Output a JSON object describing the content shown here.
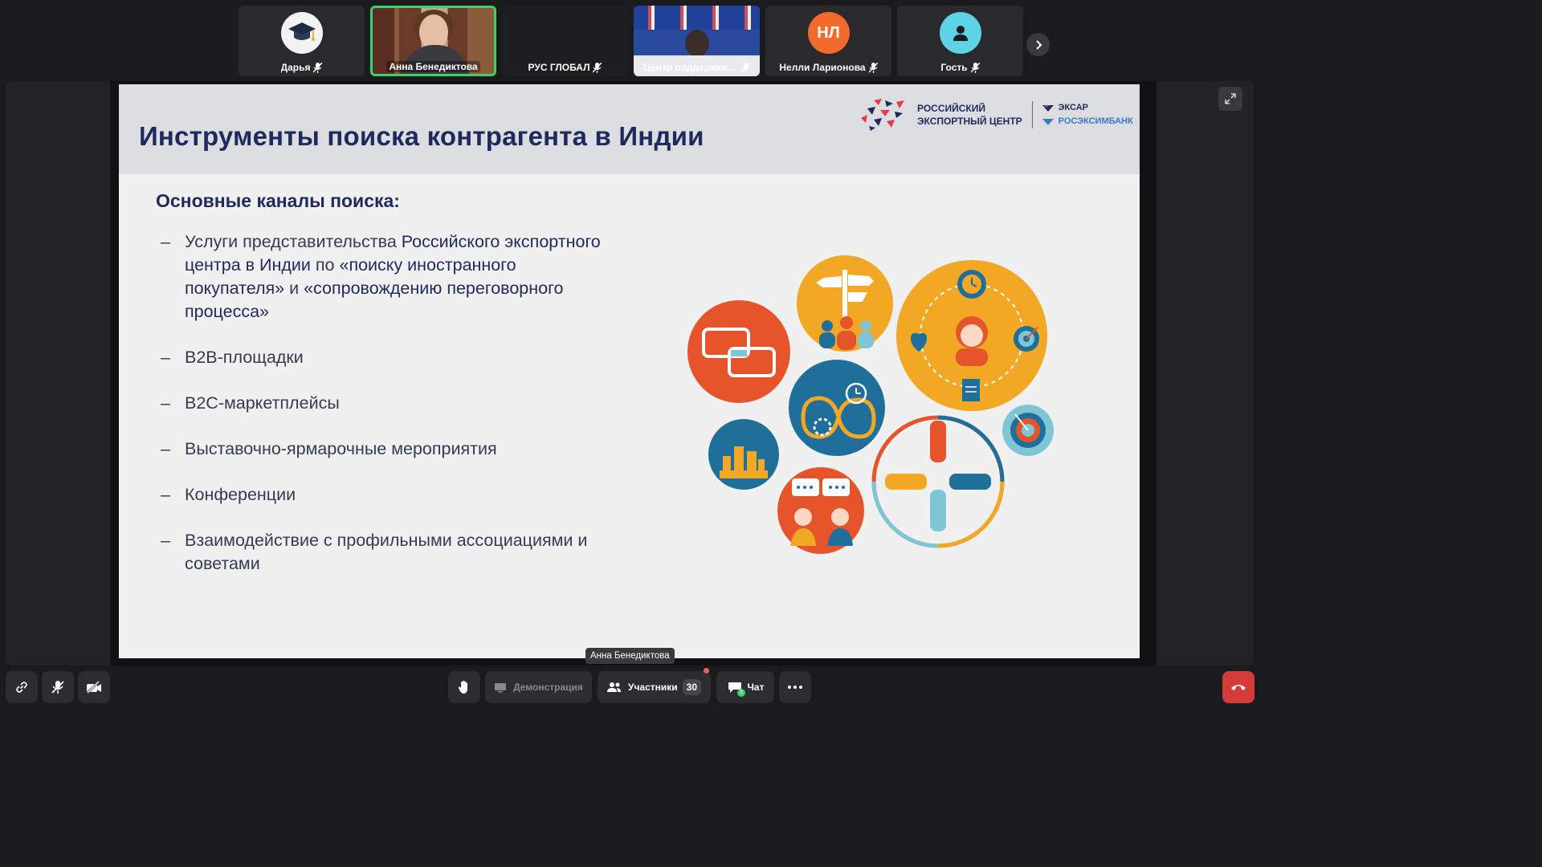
{
  "participants": [
    {
      "name": "Дарья",
      "type": "avatar-graduation"
    },
    {
      "name": "Анна Бенедиктова",
      "type": "video",
      "active": true
    },
    {
      "name": "РУС ГЛОБАЛ",
      "type": "empty"
    },
    {
      "name": "Центр поддержки ...",
      "type": "video"
    },
    {
      "name": "Нелли Ларионова",
      "type": "initials",
      "initials": "НЛ"
    },
    {
      "name": "Гость",
      "type": "avatar-guest"
    }
  ],
  "slide": {
    "title": "Инструменты поиска контрагента в Индии",
    "logo_rec_line1": "РОССИЙСКИЙ",
    "logo_rec_line2": "ЭКСПОРТНЫЙ ЦЕНТР",
    "logo_exiar": "ЭКСАР",
    "logo_roseximbank": "РОСЭКСИМБАНК",
    "subtitle": "Основные каналы поиска:",
    "bullet1": {
      "p1": "Услуги представительства ",
      "b1": "Российского экспортного центра в Индии",
      "p2": " по ",
      "b2": "«поиску иностранного покупателя»",
      "p3": " и ",
      "b3": "«сопровождению переговорного процесса»"
    },
    "bullets": [
      "B2B-площадки",
      "B2C-маркетплейсы",
      "Выставочно-ярмарочные мероприятия",
      "Конференции",
      "Взаимодействие с профильными ассоциациями и советами"
    ],
    "dash": "–"
  },
  "speaker_label": "Анна Бенедиктова",
  "toolbar": {
    "demo_label": "Демонстрация",
    "participants_label": "Участники",
    "participants_count": "30",
    "chat_label": "Чат",
    "chat_unread": "1"
  },
  "colors": {
    "accent_green": "#3bd16f",
    "hangup_red": "#d43b3b",
    "slide_navy": "#1f2a5c",
    "illus_orange": "#e6542c",
    "illus_yellow": "#f2a824",
    "illus_blue": "#1f6f9a"
  }
}
